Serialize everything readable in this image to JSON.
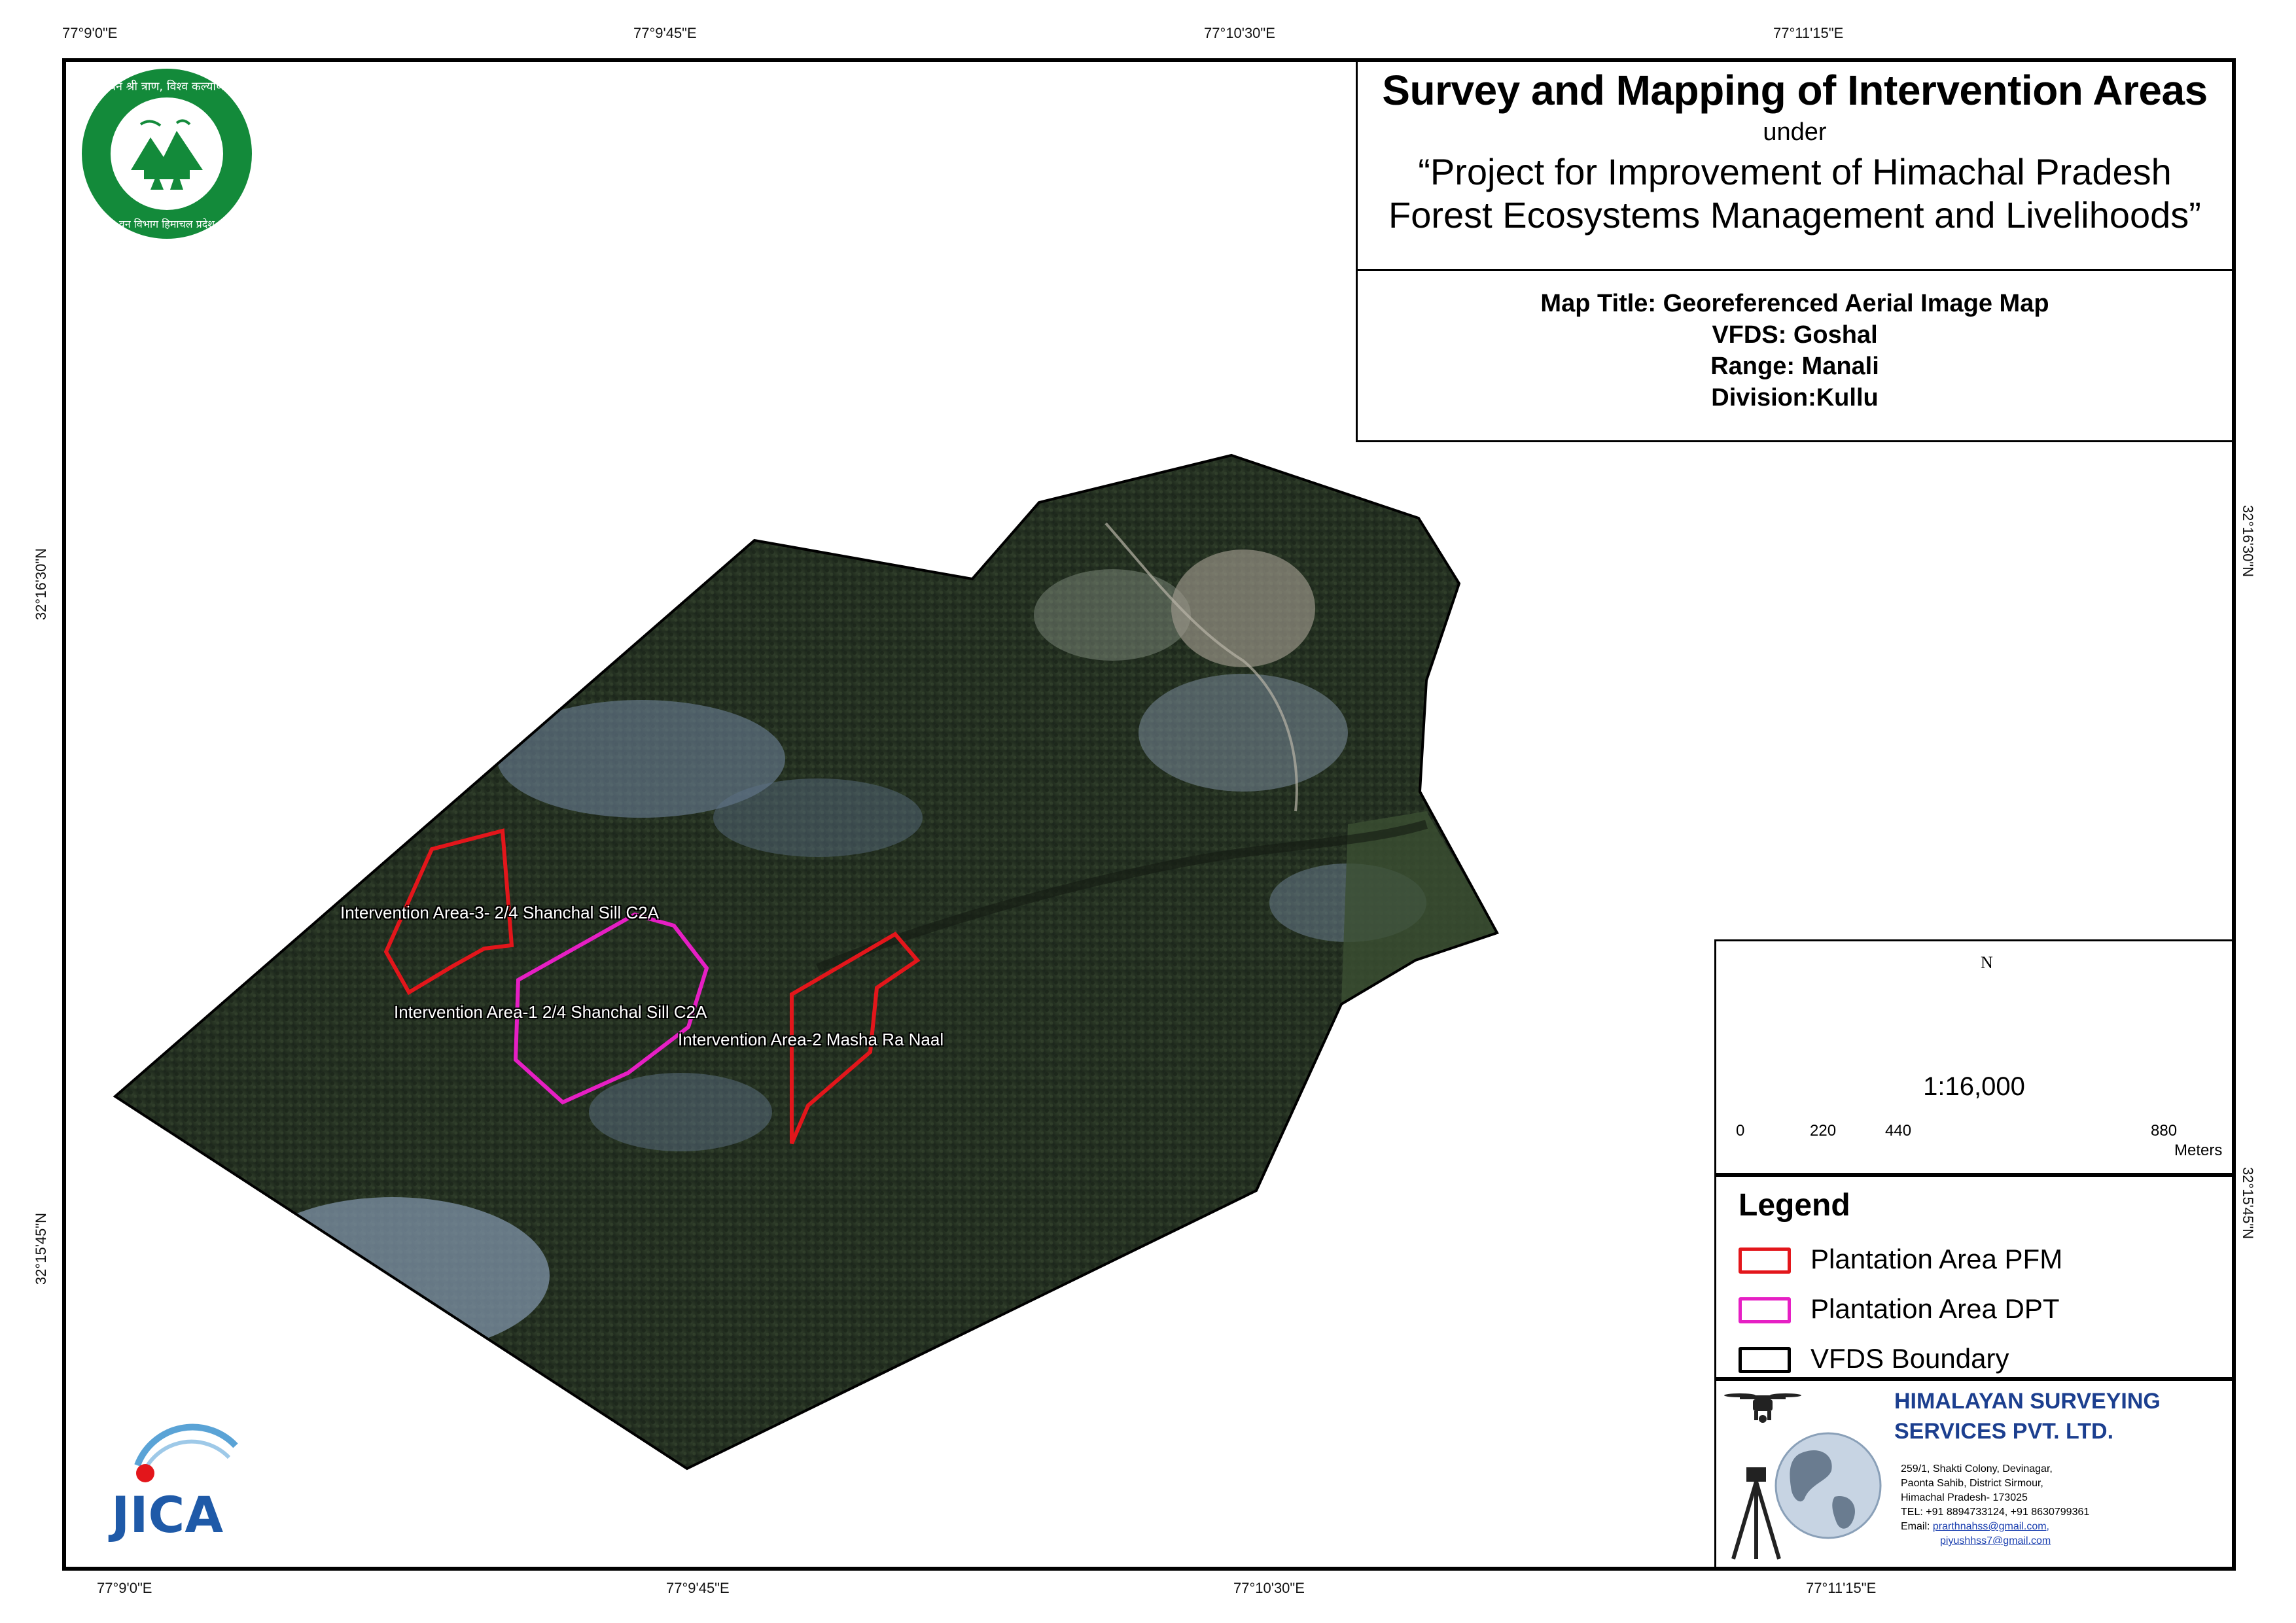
{
  "header": {
    "title": "Survey and Mapping of Intervention Areas",
    "under": "under",
    "project_line1": "“Project for Improvement of Himachal Pradesh",
    "project_line2": "Forest Ecosystems Management and Livelihoods”"
  },
  "info": {
    "map_title": "Map Title: Georeferenced Aerial Image Map",
    "vfds": "VFDS: Goshal",
    "range": "Range: Manali",
    "division": "Division:Kullu"
  },
  "coordinates": {
    "top": [
      "77°9'0\"E",
      "77°9'45\"E",
      "77°10'30\"E",
      "77°11'15\"E"
    ],
    "bottom": [
      "77°9'0\"E",
      "77°9'45\"E",
      "77°10'30\"E",
      "77°11'15\"E"
    ],
    "left": [
      "32°16'30\"N",
      "32°15'45\"N"
    ],
    "right": [
      "32°16'30\"N",
      "32°15'45\"N"
    ]
  },
  "north_arrow": {
    "letter": "N"
  },
  "scale": {
    "ratio": "1:16,000",
    "ticks": [
      "0",
      "220",
      "440",
      "880"
    ],
    "unit": "Meters"
  },
  "legend": {
    "title": "Legend",
    "items": [
      {
        "label": "Plantation Area PFM",
        "color": "#e3161b"
      },
      {
        "label": "Plantation Area DPT",
        "color": "#e61fc4"
      },
      {
        "label": "VFDS Boundary",
        "color": "#000000"
      }
    ]
  },
  "map_labels": {
    "area3": "Intervention Area-3- 2/4  Shanchal Sill C2A",
    "area1": "Intervention Area-1 2/4  Shanchal Sill C2A",
    "area2": "Intervention Area-2 Masha Ra Naal"
  },
  "company": {
    "name_line1": "HIMALAYAN SURVEYING",
    "name_line2": "SERVICES PVT. LTD.",
    "address1": "259/1, Shakti Colony, Devinagar,",
    "address2": "Paonta Sahib, District Sirmour,",
    "address3": "Himachal Pradesh- 173025",
    "tel": "TEL: +91 8894733124, +91 8630799361",
    "email_label": "Email:",
    "email1": "prarthnahss@gmail.com,",
    "email2": "piyushhss7@gmail.com"
  },
  "logos": {
    "hp_forest_text": "वन श्री त्राण, विश्व कल्याण",
    "hp_forest_bottom": "वन विभाग हिमाचल प्रदेश",
    "jica": "JICA"
  },
  "colors": {
    "pfm": "#e3161b",
    "dpt": "#e61fc4",
    "boundary": "#000000",
    "company": "#1c3f8f",
    "hp_green": "#138a3a",
    "jica_blue": "#1f5aa8",
    "jica_red": "#e3161b"
  }
}
